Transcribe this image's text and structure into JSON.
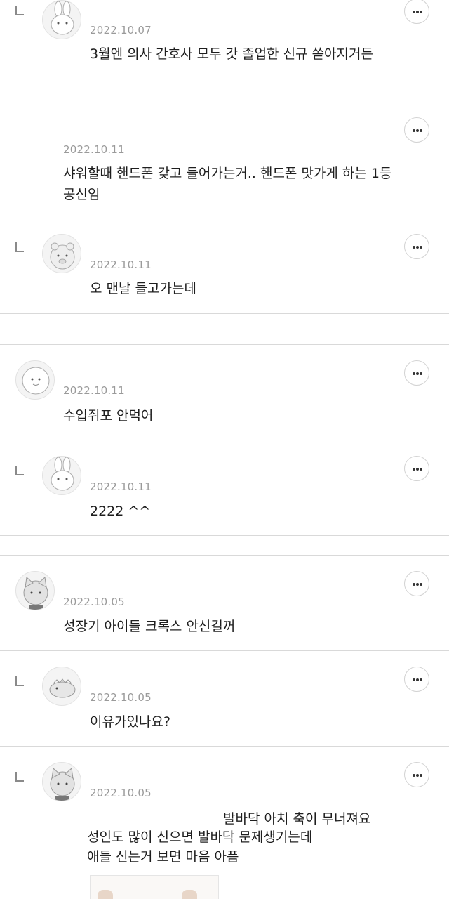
{
  "comments": [
    {
      "id": "c1",
      "date": "2022.10.07",
      "lines": [
        "3월엔 의사 간호사 모두 갓 졸업한 신규 쏟아지거든"
      ],
      "avatar": "rabbit-avatar-icon"
    },
    {
      "id": "c2",
      "date": "2022.10.11",
      "lines": [
        "샤워할때 핸드폰 갖고 들어가는거.. 핸드폰 맛가게 하는 1등",
        "공신임"
      ],
      "avatar": ""
    },
    {
      "id": "c3",
      "date": "2022.10.11",
      "lines": [
        "오 맨날 들고가는데"
      ],
      "avatar": "bear-avatar-icon"
    },
    {
      "id": "c4",
      "date": "2022.10.11",
      "lines": [
        "수입쥐포 안먹어"
      ],
      "avatar": "round-face-avatar-icon"
    },
    {
      "id": "c5",
      "date": "2022.10.11",
      "lines": [
        "2222 ^^"
      ],
      "avatar": "rabbit-avatar-icon"
    },
    {
      "id": "c6",
      "date": "2022.10.05",
      "lines": [
        "성장기 아이들 크록스 안신길꺼"
      ],
      "avatar": "cat-avatar-icon"
    },
    {
      "id": "c7",
      "date": "2022.10.05",
      "lines": [
        "이유가있나요?"
      ],
      "avatar": "dinosaur-avatar-icon"
    },
    {
      "id": "c8",
      "date": "2022.10.05",
      "lines": [
        "발바닥 아치 축이 무너져요",
        "성인도 많이 신으면 발바닥 문제생기는데",
        "애들 신는거 보면 마음 아픔"
      ],
      "avatar": "cat-avatar-icon"
    }
  ],
  "icons": {
    "more": "more-options-icon",
    "reply": "reply-arrow-icon"
  }
}
